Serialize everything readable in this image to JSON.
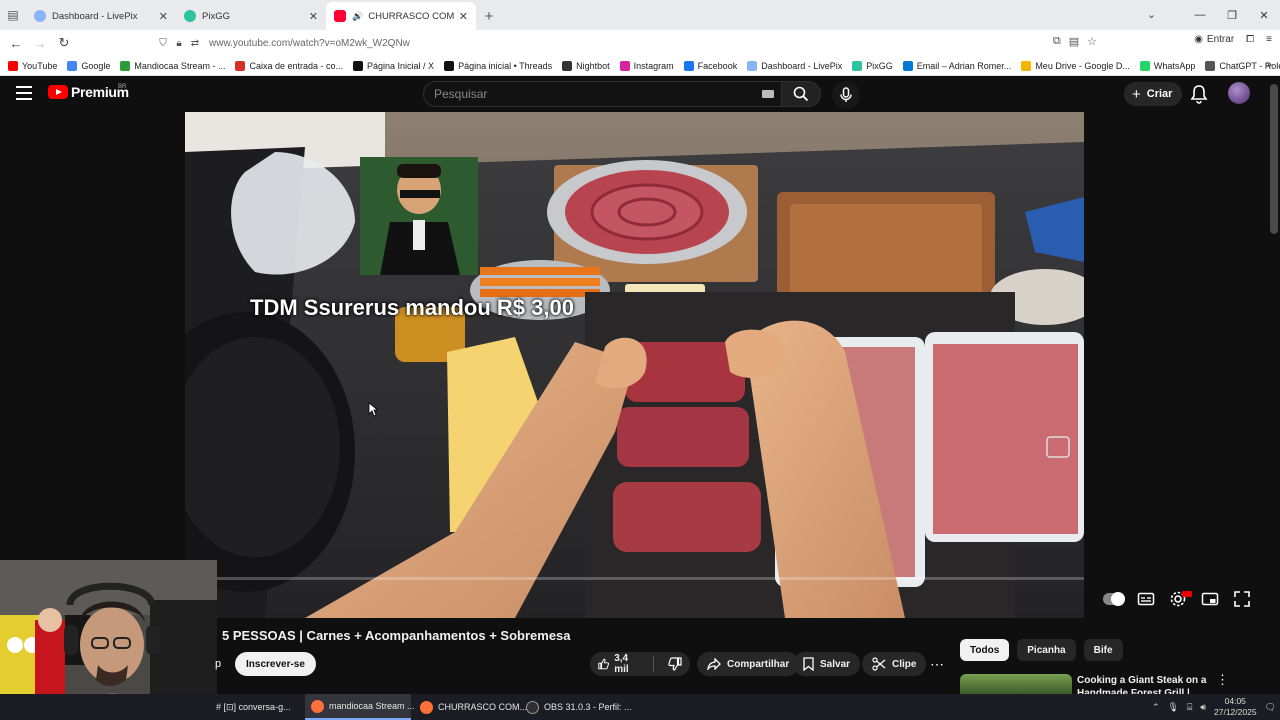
{
  "browser": {
    "tabs": [
      {
        "title": "Dashboard - LivePix",
        "active": false,
        "fav_color": "#8ab4f8"
      },
      {
        "title": "PixGG",
        "active": false,
        "fav_color": "#2fc2a2"
      },
      {
        "title": "CHURRASCO COMPLETO p",
        "active": true,
        "fav_color": "#ff0033"
      }
    ],
    "url": "www.youtube.com/watch?v=oM2wk_W2QNw",
    "signin_label": "Entrar"
  },
  "bookmarks": [
    {
      "label": "YouTube",
      "color": "#ff0000"
    },
    {
      "label": "Google",
      "color": "#4285f4"
    },
    {
      "label": "Mandiocaa Stream - ...",
      "color": "#2a9d3a"
    },
    {
      "label": "Caixa de entrada - co...",
      "color": "#d93025"
    },
    {
      "label": "Página Inicial / X",
      "color": "#111111"
    },
    {
      "label": "Página inicial • Threads",
      "color": "#111111"
    },
    {
      "label": "Nightbot",
      "color": "#333333"
    },
    {
      "label": "Instagram",
      "color": "#d6249f"
    },
    {
      "label": "Facebook",
      "color": "#1877f2"
    },
    {
      "label": "Dashboard - LivePix",
      "color": "#8ab4f8"
    },
    {
      "label": "PixGG",
      "color": "#2fc2a2"
    },
    {
      "label": "Email – Adrian Romer...",
      "color": "#0078d4"
    },
    {
      "label": "Meu Drive - Google D...",
      "color": "#f4b400"
    },
    {
      "label": "WhatsApp",
      "color": "#25d366"
    },
    {
      "label": "ChatGPT - Roleta Com...",
      "color": "#555555"
    }
  ],
  "youtube": {
    "logo_text": "Premium",
    "country_code": "BR",
    "search_placeholder": "Pesquisar",
    "create_label": "Criar"
  },
  "video": {
    "overlay_text": "TDM Ssurerus mandou R$ 3,00",
    "progress_fraction": 0.005,
    "title": "5 PESSOAS | Carnes + Acompanhamentos + Sobremesa",
    "channel_fragment": "p",
    "subscribe_label": "Inscrever-se",
    "likes": "3,4 mil",
    "share_label": "Compartilhar",
    "save_label": "Salvar",
    "clip_label": "Clipe"
  },
  "sidebar": {
    "chips": [
      "Todos",
      "Picanha",
      "Bife"
    ],
    "active_chip": "Todos",
    "recommendation_title": "Cooking a Giant Steak on a Handmade Forest Grill |"
  },
  "taskbar": {
    "tasks": [
      {
        "label": "# [⊡] conversa-g...",
        "color": "#5865f2",
        "active": false
      },
      {
        "label": "mandiocaa Stream ...",
        "color": "#ff7139",
        "active": true
      },
      {
        "label": "CHURRASCO COM...",
        "color": "#ff7139",
        "active": false
      },
      {
        "label": "OBS 31.0.3 - Perfil: ...",
        "color": "#302e31",
        "active": false
      }
    ],
    "time": "04:05",
    "date": "27/12/2025"
  }
}
